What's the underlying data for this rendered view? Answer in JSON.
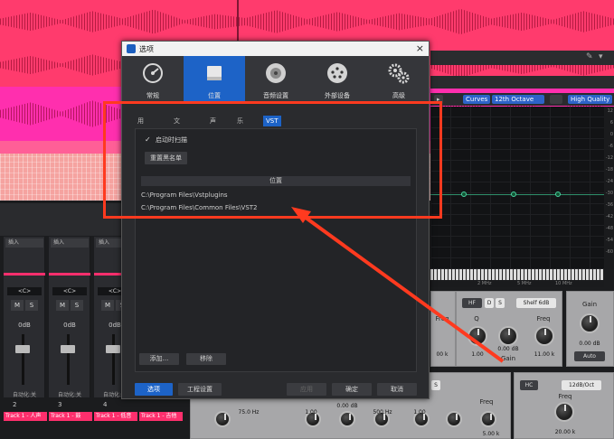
{
  "dialog": {
    "title": "选项",
    "close_symbol": "×",
    "categories": [
      {
        "label": "常规",
        "icon": "gauge-icon"
      },
      {
        "label": "位置",
        "icon": "drive-icon"
      },
      {
        "label": "音频设置",
        "icon": "speaker-icon"
      },
      {
        "label": "外部设备",
        "icon": "midi-port-icon"
      },
      {
        "label": "高级",
        "icon": "gears-icon"
      }
    ],
    "tabs": [
      "用户数据",
      "文件类型",
      "声音集",
      "乐器库",
      "VST插件"
    ],
    "active_tab": "VST插件",
    "scan_on_startup_label": "启动时扫描",
    "scan_checked": "✓",
    "reset_blacklist_label": "重置黑名单",
    "location_header": "位置",
    "paths": [
      "C:\\Program Files\\Vstplugins",
      "C:\\Program Files\\Common Files\\VST2"
    ],
    "add_label": "添加...",
    "remove_label": "移除",
    "footer": {
      "options_label": "选项",
      "project_settings_label": "工程设置",
      "apply_label": "应用",
      "ok_label": "确定",
      "cancel_label": "取消"
    }
  },
  "eq": {
    "curves_label": "Curves",
    "octave_label": "12th Octave",
    "high_quality_label": "High Quality",
    "db_ticks": [
      "12",
      "6",
      "0",
      "-6",
      "-12",
      "-18",
      "-24",
      "-30",
      "-36",
      "-42",
      "-48",
      "-54",
      "-60"
    ],
    "freq_ticks": [
      "2 MHz",
      "5 MHz",
      "10 MHz"
    ],
    "band1": {
      "type_label": "HF",
      "d_label": "D",
      "s_label": "S",
      "shelf_label": "Shelf 6dB",
      "freq_label": "Freq",
      "q_label": "Q",
      "q_value": "1.00",
      "gain_value": "0.00 dB",
      "gain_label": "Gain",
      "freq_value": "11.00 k"
    },
    "band_left": {
      "freq_label": "Freq",
      "freq_value": "00 k"
    },
    "gain_panel": {
      "label": "Gain",
      "value": "0.00 dB",
      "auto_label": "Auto"
    },
    "band_lower": {
      "d_label": "D",
      "s_label": "S",
      "freq_label": "Freq",
      "q_values": [
        "1.00",
        "1.00"
      ],
      "gain_value": "0.00 dB",
      "freq_values": [
        "75.0 Hz",
        "500 Hz",
        "5.00 k"
      ]
    },
    "hc": {
      "label": "HC",
      "slope_label": "12dB/Oct",
      "freq_label": "Freq",
      "freq_value": "20.00 k"
    }
  },
  "mixer": {
    "insert_label": "插入",
    "pan_label": "<C>",
    "mute_label": "M",
    "solo_label": "S",
    "db_label": "0dB",
    "auto_label": "自动化:关",
    "track_numbers": [
      "2",
      "3",
      "4",
      "5"
    ],
    "track_names": [
      "Track 1 - 人声",
      "Track 1 - 鼓",
      "Track 1 - 低音",
      "Track 1 - 吉他"
    ]
  },
  "colors": {
    "accent": "#1d63c7",
    "track_pink": "#ff3b6d",
    "track_magenta": "#ff2fae",
    "annotation_red": "#ff3a1f"
  }
}
